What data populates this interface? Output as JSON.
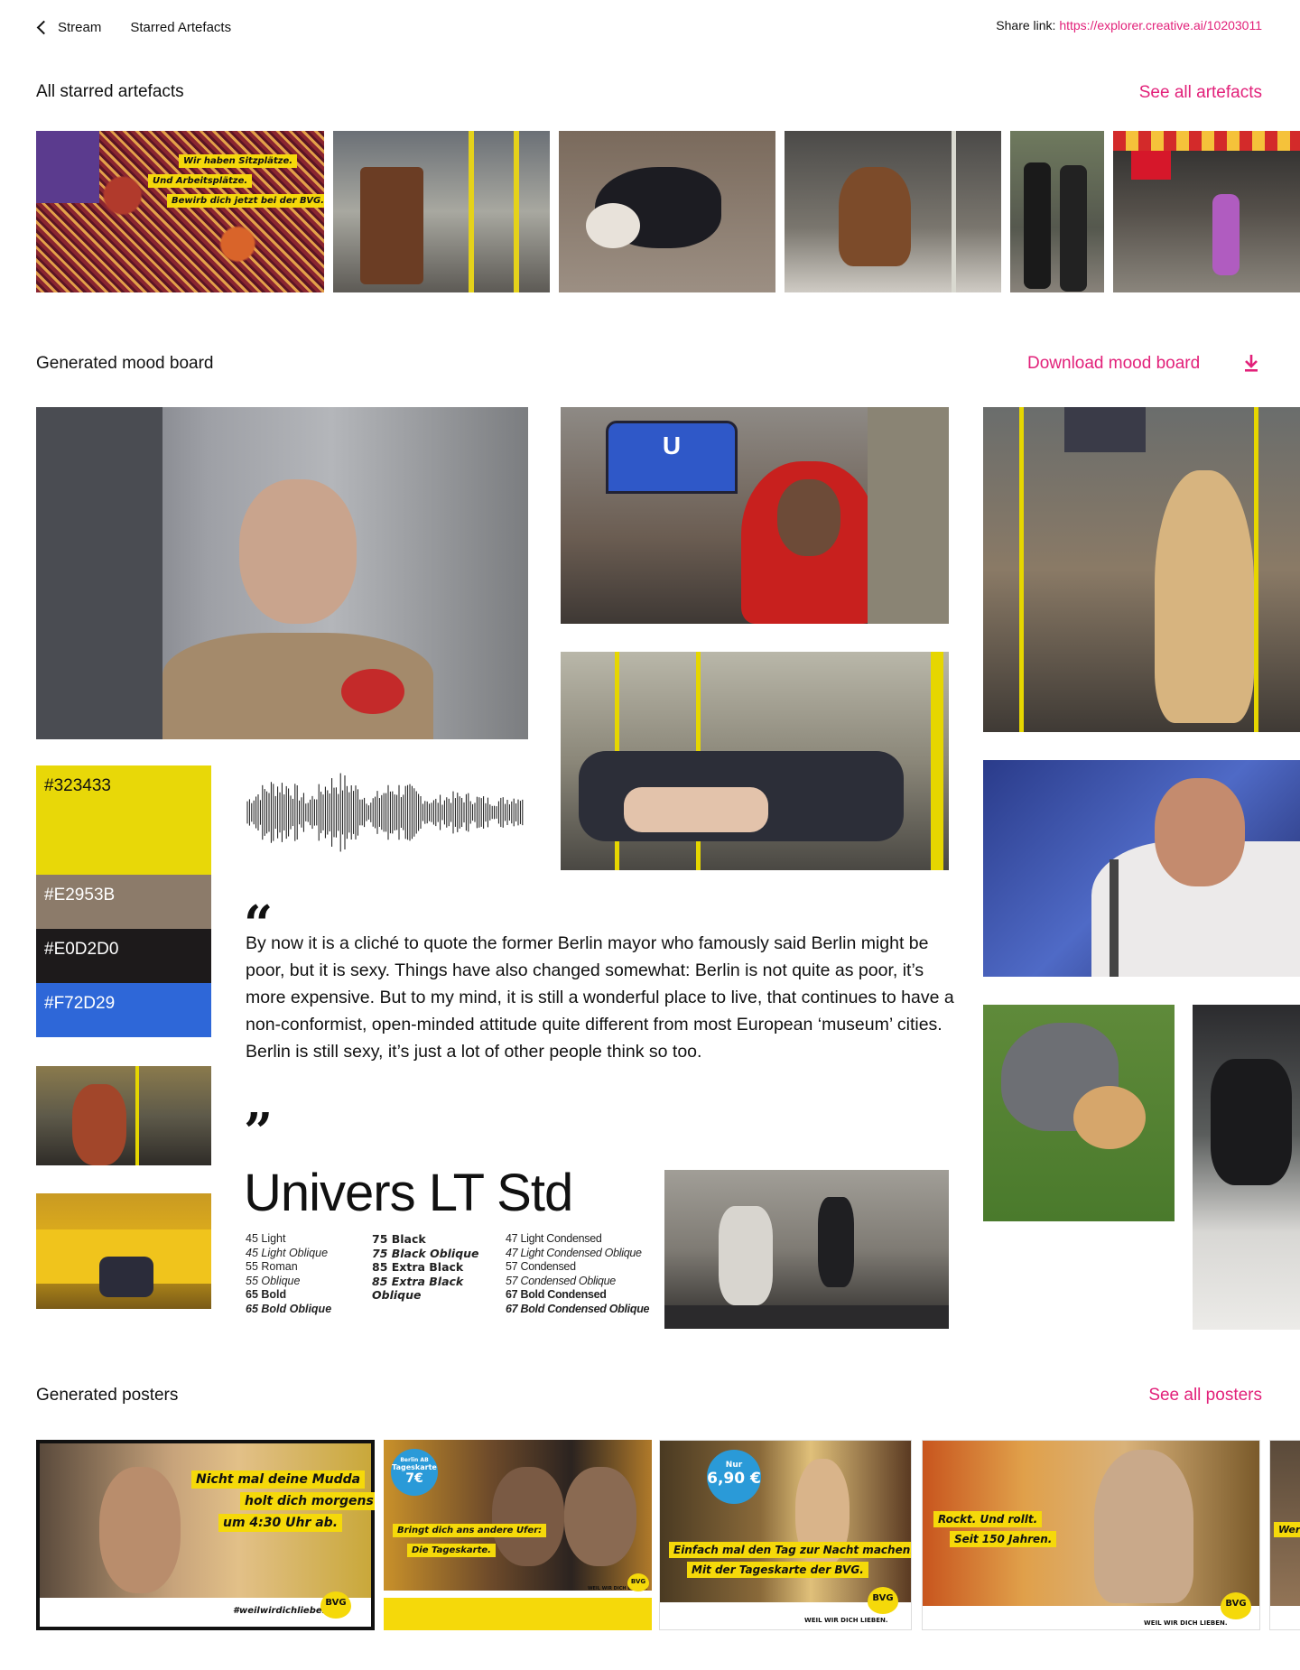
{
  "nav": {
    "back_label": "Stream",
    "current_label": "Starred Artefacts",
    "share_prefix": "Share link:",
    "share_url": "https://explorer.creative.ai/10203011"
  },
  "starred": {
    "title": "All starred artefacts",
    "see_all": "See all artefacts",
    "items": [
      {
        "name": "Seat pattern with BVG slogan",
        "overlay": [
          "Wir haben Sitzplätze.",
          "Und Arbeitsplätze.",
          "Bewirb dich jetzt bei der BVG."
        ]
      },
      {
        "name": "Couch in subway car"
      },
      {
        "name": "Bulldog in orca costume"
      },
      {
        "name": "Pony on the train"
      },
      {
        "name": "Two men in leather"
      },
      {
        "name": "Street with Turkish flag"
      }
    ]
  },
  "moodboard": {
    "title": "Generated mood board",
    "download": "Download mood board",
    "palette": [
      {
        "label": "#323433",
        "color": "#e8d808",
        "text_color": "#111111"
      },
      {
        "label": "#E2953B",
        "color": "#8c7b6a",
        "text_color": "#ffffff"
      },
      {
        "label": "#E0D2D0",
        "color": "#1d1a1b",
        "text_color": "#ffffff"
      },
      {
        "label": "#F72D29",
        "color": "#2e67d8",
        "text_color": "#ffffff"
      }
    ],
    "quote": "By now it is a cliché to quote the former Berlin mayor who famously said Berlin might be poor, but it is sexy. Things have also changed somewhat: Berlin is not quite as poor, it’s more expensive. But to my mind, it is still a wonderful place to live, that continues to have a non-conformist, open-minded attitude quite different from most European ‘museum’ cities. Berlin is still sexy, it’s just a lot of other people think so too.",
    "quote_open": "“",
    "quote_close": "”",
    "subway_sign": "U",
    "font": {
      "name": "Univers LT Std",
      "col1": [
        "45 Light",
        "45 Light Oblique",
        "55 Roman",
        "55 Oblique",
        "65 Bold",
        "65 Bold Oblique"
      ],
      "col2": [
        "75 Black",
        "75 Black Oblique",
        "85 Extra Black",
        "85 Extra Black",
        "Oblique"
      ],
      "col3": [
        "47 Light Condensed",
        "47 Light Condensed Oblique",
        "57 Condensed",
        "57 Condensed Oblique",
        "67 Bold Condensed",
        "67 Bold Condensed Oblique"
      ]
    }
  },
  "posters": {
    "title": "Generated posters",
    "see_all": "See all posters",
    "items": [
      {
        "lines": [
          "Nicht mal deine Mudda",
          "holt dich morgens",
          "um 4:30 Uhr ab."
        ],
        "footer": "#weilwirdichlieben",
        "logo": "BVG"
      },
      {
        "badge_top": "Berlin AB",
        "badge_mid": "Tageskarte",
        "badge_price": "7€",
        "lines": [
          "Bringt dich ans andere Ufer:",
          "Die Tageskarte."
        ],
        "logo": "BVG",
        "footer": "WEIL WIR DICH LIEBEN."
      },
      {
        "badge_top": "Nur",
        "badge_price": "6,90 €",
        "lines": [
          "Einfach mal den Tag zur Nacht machen.",
          "Mit der Tageskarte der BVG."
        ],
        "logo": "BVG",
        "footer": "WEIL WIR DICH LIEBEN."
      },
      {
        "lines": [
          "Rockt. Und rollt.",
          "Seit 150 Jahren."
        ],
        "logo": "BVG",
        "footer": "WEIL WIR DICH LIEBEN."
      },
      {
        "lines": [
          "Wer"
        ]
      }
    ]
  }
}
